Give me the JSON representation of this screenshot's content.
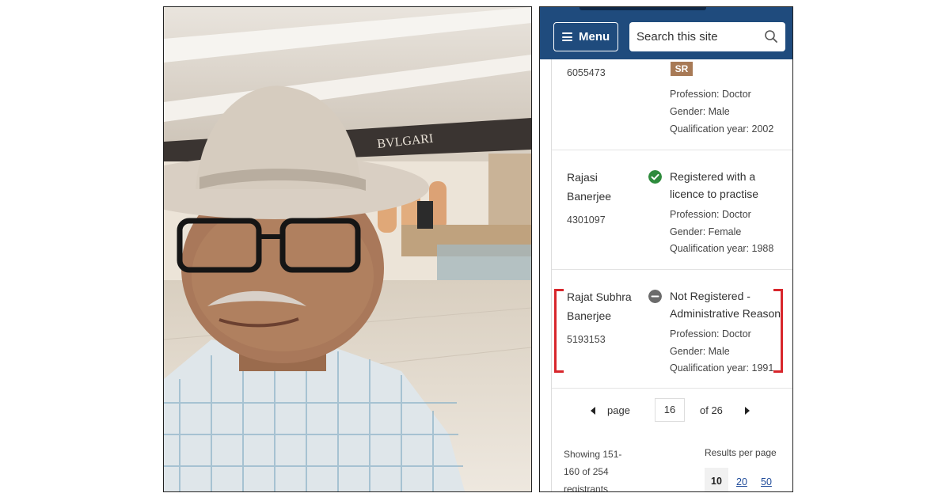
{
  "header": {
    "menu_label": "Menu",
    "search_placeholder": "Search this site"
  },
  "entries": [
    {
      "reg_no": "6055473",
      "badge": "SR",
      "profession": "Profession: Doctor",
      "gender": "Gender: Male",
      "qualification": "Qualification year: 2002"
    },
    {
      "name_line1": "Rajasi",
      "name_line2": "Banerjee",
      "reg_no": "4301097",
      "status_line1": "Registered with a",
      "status_line2": "licence to practise",
      "profession": "Profession: Doctor",
      "gender": "Gender: Female",
      "qualification": "Qualification year: 1988"
    },
    {
      "name_line1": "Rajat Subhra",
      "name_line2": "Banerjee",
      "reg_no": "5193153",
      "status_line1": "Not Registered -",
      "status_line2": "Administrative Reason",
      "profession": "Profession: Doctor",
      "gender": "Gender: Male",
      "qualification": "Qualification year: 1991"
    }
  ],
  "pagination": {
    "page_label": "page",
    "current_page": "16",
    "of_label": "of 26"
  },
  "footer": {
    "showing_line1": "Showing 151-",
    "showing_line2": "160 of 254",
    "showing_line3": "registrants",
    "results_per_page_label": "Results per page",
    "options": [
      "10",
      "20",
      "50"
    ],
    "selected": "10"
  },
  "colors": {
    "header_bg": "#1f4b7d",
    "registered_green": "#2e8b3c",
    "not_registered_grey": "#6b6b6b",
    "highlight_red": "#d8262c",
    "badge_brown": "#a87a56"
  },
  "icons": [
    "hamburger-icon",
    "search-icon",
    "check-circle-icon",
    "minus-circle-icon",
    "arrow-left-icon",
    "arrow-right-icon"
  ]
}
